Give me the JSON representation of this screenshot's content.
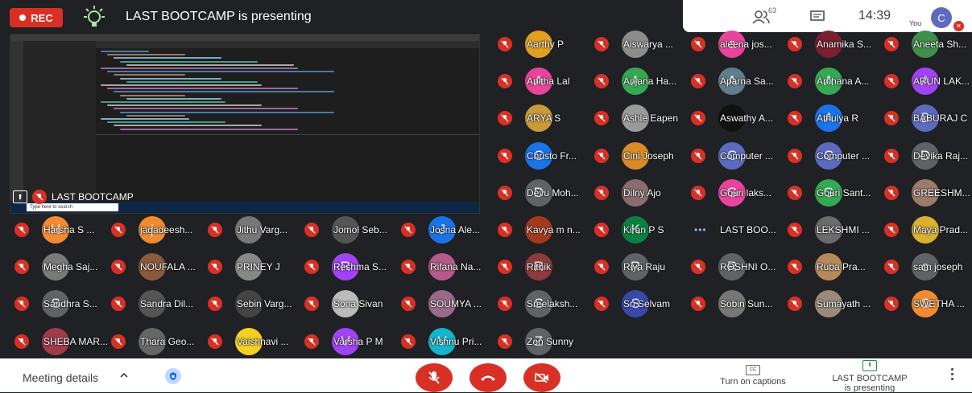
{
  "topbar": {
    "rec_label": "REC",
    "presenting_text": "LAST BOOTCAMP is presenting",
    "participant_count": "63",
    "time": "14:39",
    "you_label": "You",
    "you_initial": "C"
  },
  "share": {
    "label": "LAST BOOTCAMP",
    "search_placeholder": "Type here to search"
  },
  "participants": [
    {
      "name": "Aarthy P",
      "initial": "",
      "color": "#e3a020",
      "col": 0,
      "row": 0
    },
    {
      "name": "Aiswarya ...",
      "initial": "",
      "color": "#8d8d8d",
      "col": 1,
      "row": 0
    },
    {
      "name": "aleena jos...",
      "initial": "a",
      "color": "#e8449b",
      "col": 2,
      "row": 0
    },
    {
      "name": "Anamika S...",
      "initial": "",
      "color": "#7a1f2e",
      "col": 3,
      "row": 0
    },
    {
      "name": "Aneeta Sh...",
      "initial": "",
      "color": "#3f8f4a",
      "col": 4,
      "row": 0
    },
    {
      "name": "Anitha Lal",
      "initial": "A",
      "color": "#e8449b",
      "col": 0,
      "row": 1
    },
    {
      "name": "Anjana Ha...",
      "initial": "A",
      "color": "#34a853",
      "col": 1,
      "row": 1
    },
    {
      "name": "Aparna Sa...",
      "initial": "A",
      "color": "#607d8b",
      "col": 2,
      "row": 1
    },
    {
      "name": "Archana A...",
      "initial": "A",
      "color": "#34a853",
      "col": 3,
      "row": 1
    },
    {
      "name": "ARUN LAK...",
      "initial": "A",
      "color": "#a142f4",
      "col": 4,
      "row": 1
    },
    {
      "name": "ARYA S",
      "initial": "",
      "color": "#c79a3a",
      "col": 0,
      "row": 2
    },
    {
      "name": "Ashle Eapen",
      "initial": "",
      "color": "#9a9a9a",
      "col": 1,
      "row": 2
    },
    {
      "name": "Aswathy A...",
      "initial": "",
      "color": "#111",
      "col": 2,
      "row": 2
    },
    {
      "name": "Athulya R",
      "initial": "A",
      "color": "#1a73e8",
      "col": 3,
      "row": 2
    },
    {
      "name": "BABURAJ C",
      "initial": "B",
      "color": "#5c6bc0",
      "col": 4,
      "row": 2
    },
    {
      "name": "Christo Fr...",
      "initial": "C",
      "color": "#1a73e8",
      "col": 0,
      "row": 3
    },
    {
      "name": "Cini Joseph",
      "initial": "",
      "color": "#d98b2a",
      "col": 1,
      "row": 3
    },
    {
      "name": "Computer ...",
      "initial": "C",
      "color": "#5c6bc0",
      "col": 2,
      "row": 3
    },
    {
      "name": "Computer ...",
      "initial": "C",
      "color": "#5c6bc0",
      "col": 3,
      "row": 3
    },
    {
      "name": "Devika Raj...",
      "initial": "D",
      "color": "#5f6368",
      "col": 4,
      "row": 3
    },
    {
      "name": "Devu Moh...",
      "initial": "D",
      "color": "#5f6368",
      "col": 0,
      "row": 4
    },
    {
      "name": "Dilny Ajo",
      "initial": "",
      "color": "#8a6d6d",
      "col": 1,
      "row": 4
    },
    {
      "name": "Gouri laks...",
      "initial": "G",
      "color": "#e8449b",
      "col": 2,
      "row": 4
    },
    {
      "name": "Gouri Sant...",
      "initial": "G",
      "color": "#34a853",
      "col": 3,
      "row": 4
    },
    {
      "name": "GREESHM...",
      "initial": "",
      "color": "#9c7b6a",
      "col": 4,
      "row": 4
    },
    {
      "name": "Harsha S ...",
      "initial": "H",
      "color": "#f28b30",
      "col": 0,
      "row": 5
    },
    {
      "name": "jagadeesh...",
      "initial": "j",
      "color": "#f28b30",
      "col": 1,
      "row": 5
    },
    {
      "name": "Jithu Varg...",
      "initial": "",
      "color": "#777",
      "col": 2,
      "row": 5
    },
    {
      "name": "Jomol Seb...",
      "initial": "",
      "color": "#555",
      "col": 3,
      "row": 5
    },
    {
      "name": "Josna Ale...",
      "initial": "J",
      "color": "#1a73e8",
      "col": 4,
      "row": 5
    },
    {
      "name": "Kavya m n...",
      "initial": "",
      "color": "#a33a1f",
      "col": 5,
      "row": 5
    },
    {
      "name": "Kiran P S",
      "initial": "K",
      "color": "#0b8043",
      "col": 6,
      "row": 5
    },
    {
      "name": "LAST BOO...",
      "initial": "",
      "color": "",
      "col": 7,
      "row": 5
    },
    {
      "name": "LEKSHMI ...",
      "initial": "",
      "color": "#6b6b6b",
      "col": 8,
      "row": 5
    },
    {
      "name": "Maya Prad...",
      "initial": "",
      "color": "#d9b030",
      "col": 9,
      "row": 5
    },
    {
      "name": "Megha Saj...",
      "initial": "",
      "color": "#7a7a7a",
      "col": 0,
      "row": 6
    },
    {
      "name": "NOUFALA ...",
      "initial": "",
      "color": "#8b5a3a",
      "col": 1,
      "row": 6
    },
    {
      "name": "PRINEY J",
      "initial": "",
      "color": "#888",
      "col": 2,
      "row": 6
    },
    {
      "name": "Reshma S...",
      "initial": "R",
      "color": "#a142f4",
      "col": 3,
      "row": 6
    },
    {
      "name": "Rifana Na...",
      "initial": "",
      "color": "#b55a8a",
      "col": 4,
      "row": 6
    },
    {
      "name": "Rithik",
      "initial": "R",
      "color": "#8d3a3a",
      "col": 5,
      "row": 6
    },
    {
      "name": "Riya Raju",
      "initial": "R",
      "color": "#5f6368",
      "col": 6,
      "row": 6
    },
    {
      "name": "ROSHNI O...",
      "initial": "R",
      "color": "#5f6368",
      "col": 7,
      "row": 6
    },
    {
      "name": "Ruba Pra...",
      "initial": "",
      "color": "#b58a5a",
      "col": 8,
      "row": 6
    },
    {
      "name": "sam joseph",
      "initial": "s",
      "color": "#5f6368",
      "col": 9,
      "row": 6
    },
    {
      "name": "Sandhra S...",
      "initial": "S",
      "color": "#5f6368",
      "col": 0,
      "row": 7
    },
    {
      "name": "Sandra Dil...",
      "initial": "",
      "color": "#555",
      "col": 1,
      "row": 7
    },
    {
      "name": "Sebin Varg...",
      "initial": "",
      "color": "#444",
      "col": 2,
      "row": 7
    },
    {
      "name": "Sona Sivan",
      "initial": "",
      "color": "#bbb",
      "col": 3,
      "row": 7
    },
    {
      "name": "SOUMYA ...",
      "initial": "",
      "color": "#9b6a8a",
      "col": 4,
      "row": 7
    },
    {
      "name": "Sreelaksh...",
      "initial": "S",
      "color": "#5f6368",
      "col": 5,
      "row": 7
    },
    {
      "name": "Sri Selvam",
      "initial": "S",
      "color": "#3949ab",
      "col": 6,
      "row": 7
    },
    {
      "name": "Sobin Sun...",
      "initial": "",
      "color": "#777",
      "col": 7,
      "row": 7
    },
    {
      "name": "Sumayath ...",
      "initial": "",
      "color": "#9a8a7a",
      "col": 8,
      "row": 7
    },
    {
      "name": "SWETHA ...",
      "initial": "S",
      "color": "#f28b30",
      "col": 9,
      "row": 7
    },
    {
      "name": "SHEBA MAR...",
      "initial": "",
      "color": "#a33a4a",
      "col": 0,
      "row": 8
    },
    {
      "name": "Thara Geo...",
      "initial": "",
      "color": "#666",
      "col": 1,
      "row": 8
    },
    {
      "name": "Vaishnavi ...",
      "initial": "",
      "color": "#f5d020",
      "col": 2,
      "row": 8
    },
    {
      "name": "Varsha P M",
      "initial": "V",
      "color": "#a142f4",
      "col": 3,
      "row": 8
    },
    {
      "name": "Vishnu Pri...",
      "initial": "V",
      "color": "#12b5cb",
      "col": 4,
      "row": 8
    },
    {
      "name": "Zen Sunny",
      "initial": "Z",
      "color": "#5f6368",
      "col": 5,
      "row": 8
    }
  ],
  "bottombar": {
    "meeting_details": "Meeting details",
    "captions_label": "Turn on captions",
    "cc_glyph": "CC",
    "presenting_line1": "LAST BOOTCAMP",
    "presenting_line2": "is presenting"
  }
}
